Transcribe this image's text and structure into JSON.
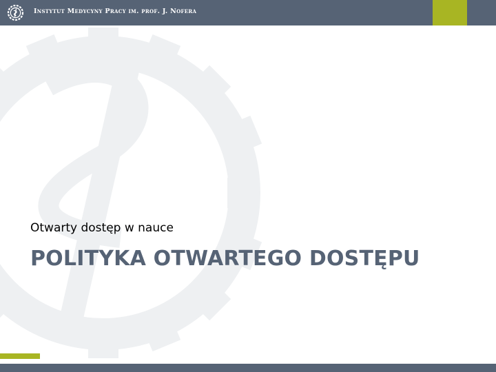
{
  "header": {
    "institution_name": "Instytut Medycyny Pracy im. prof. J. Nofera",
    "logo_icon": "caduceus-gear-icon"
  },
  "slide": {
    "subtitle": "Otwarty dostęp w nauce",
    "title": "POLITYKA OTWARTEGO DOSTĘPU",
    "background_icon": "gear-serpent-emblem-icon"
  },
  "colors": {
    "header_bar": "#566375",
    "accent_green": "#a8b523",
    "title_text": "#566375",
    "emblem": "#eef0f2"
  }
}
